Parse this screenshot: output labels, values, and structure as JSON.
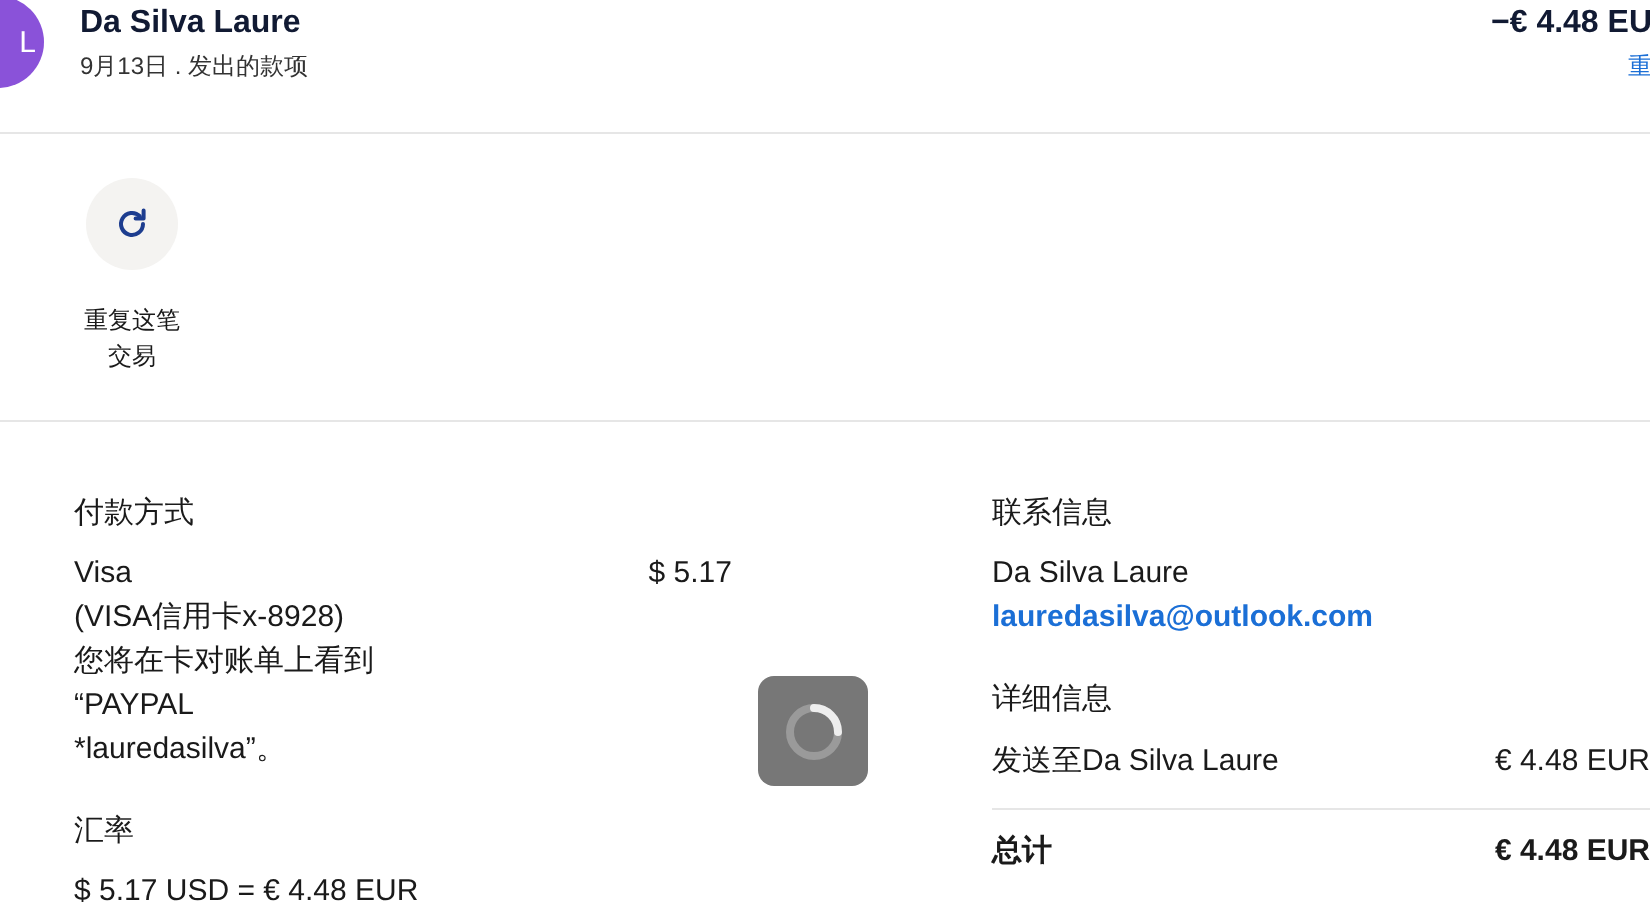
{
  "header": {
    "avatar_initials": "L",
    "name": "Da Silva Laure",
    "subtitle": "9月13日 . 发出的款项",
    "amount": "−€ 4.48 EU",
    "link": "重"
  },
  "actions": [
    {
      "label_lines": [
        "重复这笔",
        "交易"
      ]
    }
  ],
  "payment": {
    "heading": "付款方式",
    "lines": [
      "Visa",
      "(VISA信用卡x-8928)",
      "您将在卡对账单上看到",
      "“PAYPAL",
      "*lauredasilva”。"
    ],
    "amount": "$ 5.17"
  },
  "exchange": {
    "heading": "汇率",
    "value": "$ 5.17 USD = € 4.48 EUR"
  },
  "contact": {
    "heading": "联系信息",
    "name": "Da Silva Laure",
    "email": "lauredasilva@outlook.com"
  },
  "details": {
    "heading": "详细信息",
    "rows": [
      {
        "label": "发送至Da Silva Laure",
        "value": "€ 4.48 EUR",
        "kind": "item"
      },
      {
        "label": "总计",
        "value": "€ 4.48 EUR",
        "kind": "total"
      }
    ]
  },
  "loading": true
}
